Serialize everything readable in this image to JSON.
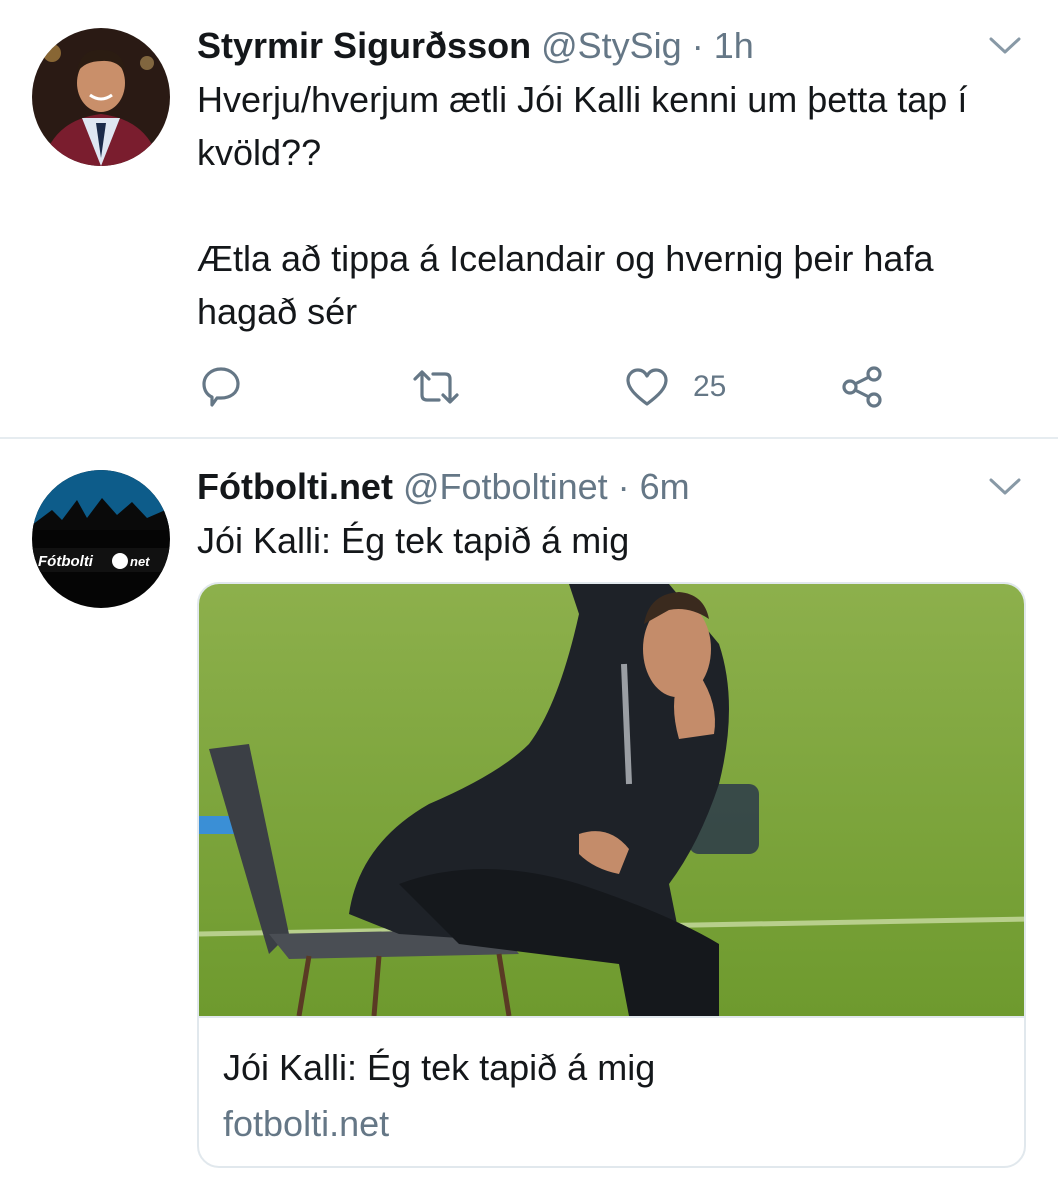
{
  "tweets": [
    {
      "name": "Styrmir Sigurðsson",
      "handle": "@StySig",
      "separator": "·",
      "time": "1h",
      "text": "Hverju/hverjum ætli Jói Kalli kenni um þetta tap í kvöld??\n\nÆtla að tippa á Icelandair og hvernig þeir hafa hagað sér",
      "likes": "25",
      "icons": [
        "reply-icon",
        "retweet-icon",
        "heart-icon",
        "share-icon",
        "chevron-down-icon"
      ]
    },
    {
      "name": "Fótbolti.net",
      "handle": "@Fotboltinet",
      "separator": "·",
      "time": "6m",
      "text": "Jói Kalli: Ég tek tapið á mig",
      "avatar_logo_text": "Fótbolti net",
      "card": {
        "title": "Jói Kalli: Ég tek tapið á mig",
        "domain": "fotbolti.net"
      },
      "icons": [
        "chevron-down-icon"
      ]
    }
  ],
  "colors": {
    "text_primary": "#14171a",
    "text_secondary": "#657786",
    "divider": "#e6ecf0",
    "grass": "#7fa83c"
  }
}
